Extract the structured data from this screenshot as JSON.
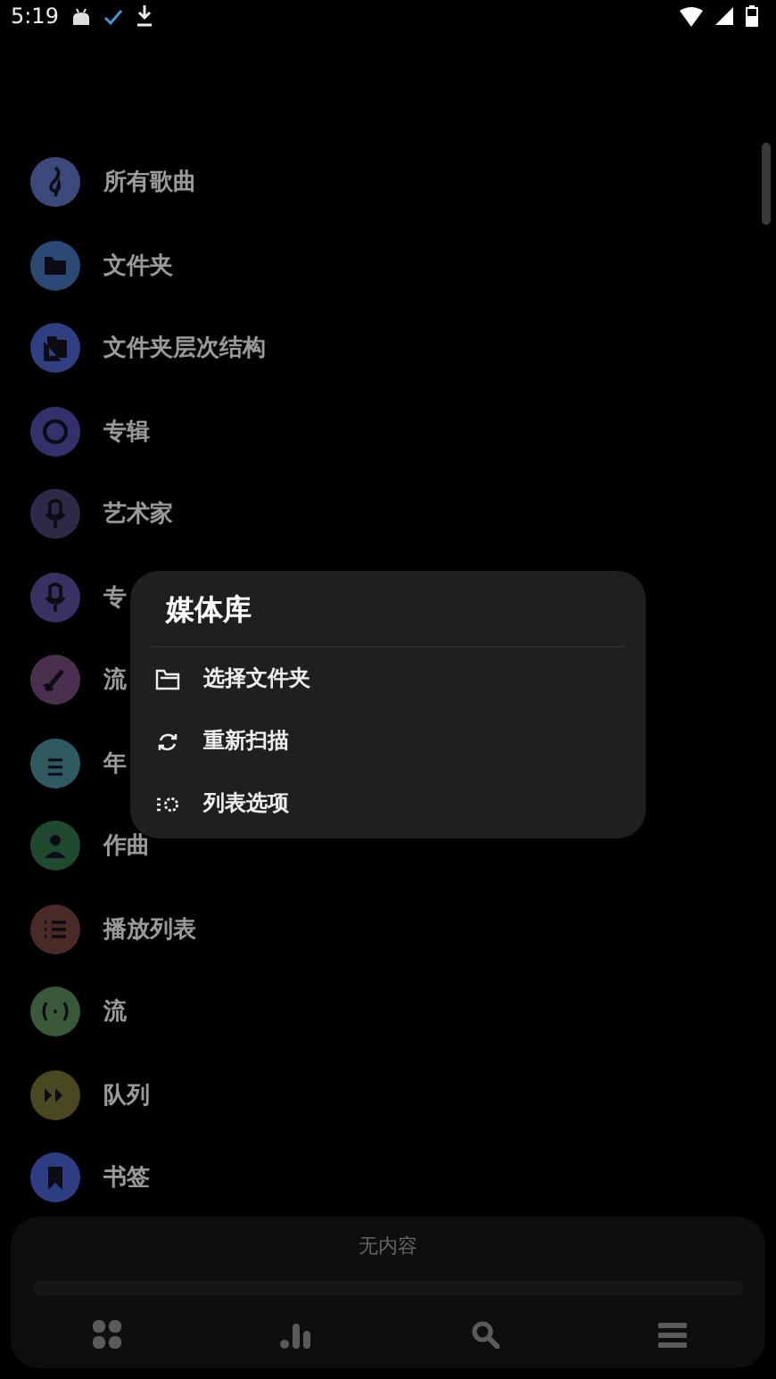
{
  "status_bar": {
    "time": "5:19"
  },
  "library_items": [
    {
      "label": "所有歌曲",
      "color": "#3b4a7a"
    },
    {
      "label": "文件夹",
      "color": "#2c4874"
    },
    {
      "label": "文件夹层次结构",
      "color": "#2f3f82"
    },
    {
      "label": "专辑",
      "color": "#34306c"
    },
    {
      "label": "艺术家",
      "color": "#2c2a46"
    },
    {
      "label": "专",
      "color": "#3a3062"
    },
    {
      "label": "流",
      "color": "#4a2f4e"
    },
    {
      "label": "年",
      "color": "#2f5a62"
    },
    {
      "label": "作曲",
      "color": "#1f4a30"
    },
    {
      "label": "播放列表",
      "color": "#4a2a26"
    },
    {
      "label": "流",
      "color": "#3a583a"
    },
    {
      "label": "队列",
      "color": "#4a4820"
    },
    {
      "label": "书签",
      "color": "#2d3e82"
    }
  ],
  "dialog": {
    "title": "媒体库",
    "items": [
      {
        "label": "选择文件夹"
      },
      {
        "label": "重新扫描"
      },
      {
        "label": "列表选项"
      }
    ]
  },
  "player": {
    "message": "无内容"
  }
}
